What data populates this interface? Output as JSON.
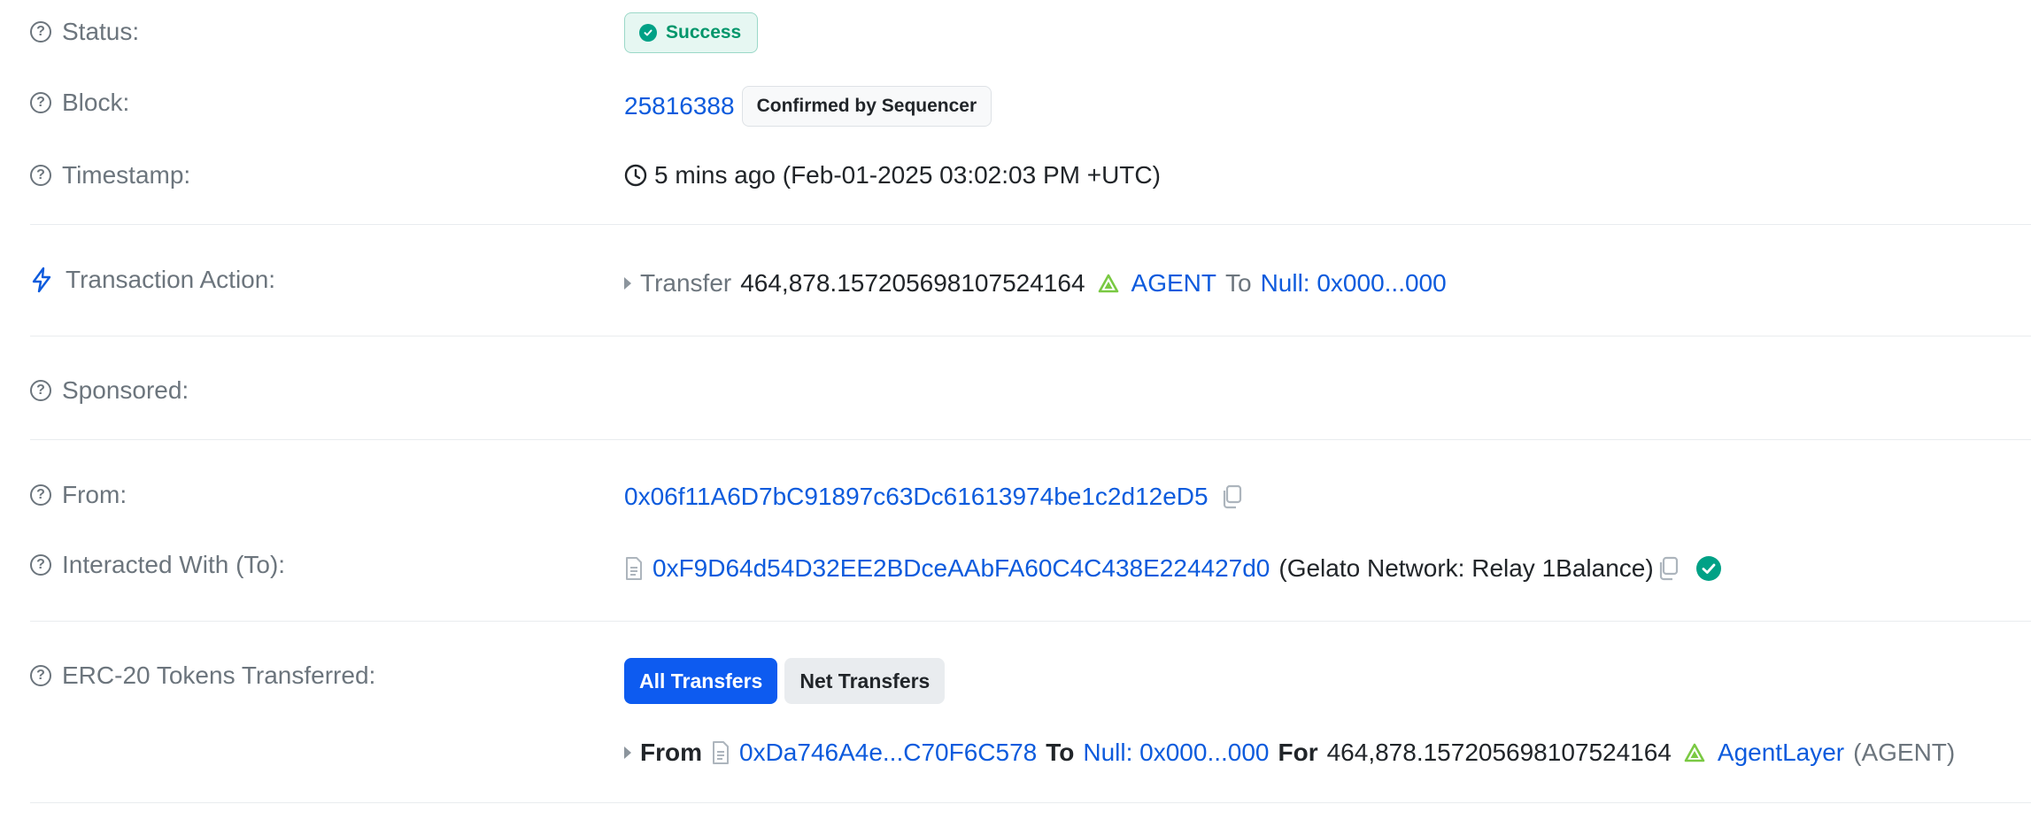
{
  "status": {
    "label": "Status:",
    "badge": "Success"
  },
  "block": {
    "label": "Block:",
    "number": "25816388",
    "confirm_badge": "Confirmed by Sequencer"
  },
  "timestamp": {
    "label": "Timestamp:",
    "value": "5 mins ago (Feb-01-2025 03:02:03 PM +UTC)"
  },
  "action": {
    "label": "Transaction Action:",
    "verb": "Transfer",
    "amount": "464,878.157205698107524164",
    "token": "AGENT",
    "to_word": "To",
    "to_address": "Null: 0x000...000"
  },
  "sponsored": {
    "label": "Sponsored:"
  },
  "from": {
    "label": "From:",
    "address": "0x06f11A6D7bC91897c63Dc61613974be1c2d12eD5"
  },
  "interacted": {
    "label": "Interacted With (To):",
    "address": "0xF9D64d54D32EE2BDceAAbFA60C4C438E224427d0",
    "name": "(Gelato Network: Relay 1Balance)"
  },
  "erc20": {
    "label": "ERC-20 Tokens Transferred:",
    "tabs": [
      "All Transfers",
      "Net Transfers"
    ],
    "transfer": {
      "from_word": "From",
      "from_address": "0xDa746A4e...C70F6C578",
      "to_word": "To",
      "to_address": "Null: 0x000...000",
      "for_word": "For",
      "amount": "464,878.157205698107524164",
      "token_name": "AgentLayer",
      "token_symbol": "(AGENT)"
    }
  },
  "colors": {
    "link": "#0d5bdd",
    "success": "#00966b",
    "primary_button": "#0d5bf0"
  },
  "icons": [
    "question-circle-icon",
    "check-circle-icon",
    "clock-icon",
    "lightning-icon",
    "caret-right-icon",
    "agent-token-icon",
    "copy-icon",
    "contract-document-icon",
    "verified-check-icon"
  ]
}
